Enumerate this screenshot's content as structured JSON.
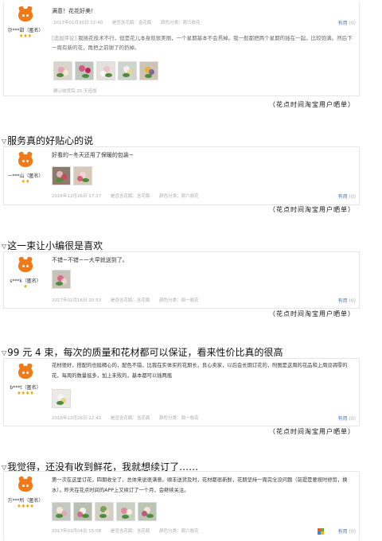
{
  "reviews": [
    {
      "user": {
        "name": "尕***甜（匿名）",
        "rank": "♦♦♦"
      },
      "text": "满意！花花好美！",
      "meta": {
        "date": "2017年01月30日 22:40",
        "vase": "是否含花瓶：含花瓶",
        "color": "颜色分类：周六收花"
      },
      "useful": {
        "label": "有用",
        "count": "(0)"
      },
      "followup": {
        "tag": "[追加评论]",
        "text": "我插花技术不行，但是花儿本身就很美丽，一个星期基本不会焉掉。我一般都把两个星期的插在一起，比较饱满。然后下一周有新的花，再把之前谢了的扔掉。",
        "meta": "确认收货后 25 天追加"
      },
      "caption": "（花点时间淘宝用户晒单）"
    },
    {
      "heading": "服务真的好贴心的说",
      "user": {
        "name": "一***山（匿名）",
        "rank": "♦♦"
      },
      "text": "好看的~冬天还用了保暖的包装~",
      "meta": {
        "date": "2016年12月26日 17:37",
        "vase": "是否含花瓶：含花瓶",
        "color": "颜色分类：周六收花"
      },
      "useful": {
        "label": "有用",
        "count": "(0)"
      },
      "caption": "（花点时间淘宝用户晒单）"
    },
    {
      "heading": "这一束让小编很是喜欢",
      "user": {
        "name": "s***k（匿名）",
        "rank": "♦"
      },
      "text": "不错~不错~一大早就送到了。",
      "meta": {
        "date": "2017年01月16日 20:53",
        "vase": "是否含花瓶：含花瓶",
        "color": "颜色分类：周一收花"
      },
      "useful": {
        "label": "有用",
        "count": "(0)"
      },
      "caption": "（花点时间淘宝用户晒单）"
    },
    {
      "heading": "99 元 4 束，每次的质量和花材都可以保证，看来性价比真的很高",
      "user": {
        "name": "b***t（匿名）",
        "rank": "♦♦♦♦"
      },
      "text": "花材很好，搭配的也挺精心的，配色不错，比我在实体买的花期长，良心卖家，以后会长期订花的，附图是这周的花品和上周没凋零的花，每周的数量挺多，加上未败的，基本都可以插两瓶",
      "meta": {
        "date": "2016年12月26日 22:42",
        "vase": "是否含花瓶：含花瓶",
        "color": "颜色分类：周一收花"
      },
      "useful": {
        "label": "有用",
        "count": "(0)"
      },
      "caption": "（花点时间淘宝用户晒单）"
    },
    {
      "heading": "我觉得，还没有收到鲜花，我就想续订了……",
      "user": {
        "name": "方***所（匿名）",
        "rank": "♦♦♦♦"
      },
      "text": "第一次在这里订花，四期收全了，总体来说很满意。顺丰送货及时，花材都很新鲜，花期坚持一周完全没问题（前提是要按时修剪，换水）。昨天在花点时间的APP上又续订了一个月，会继续关注。",
      "meta": {
        "date": "2017年03月04日 15:08",
        "vase": "是否含花瓶：含花瓶",
        "color": "颜色分类：周六收花"
      },
      "useful": {
        "label": "有用",
        "count": "(0)"
      }
    }
  ]
}
